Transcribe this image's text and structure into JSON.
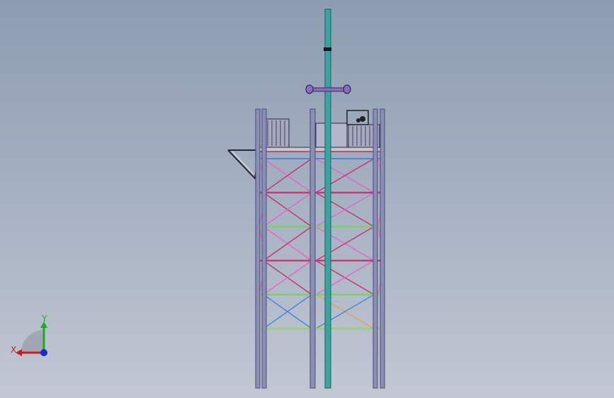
{
  "viewport": {
    "background_top": "#8d9cb1",
    "background_bottom": "#c2c7d3"
  },
  "model": {
    "description_icon": "steel-lattice-tower-model",
    "colors": {
      "column": "#8b8fb8",
      "column_edge": "#4a4d6e",
      "mast": "#3aa5a0",
      "mast_edge": "#1d5f5c",
      "brace_pink": "#e06ac8",
      "brace_magenta": "#c43a78",
      "brace_blue": "#4a8ad8",
      "brace_orange": "#e0a060",
      "beam_green": "#7ad06a",
      "platform": "#c8c8c8"
    }
  },
  "triad": {
    "x_label": "X",
    "y_label": "Y",
    "x_color": "#d11a1a",
    "y_color": "#18b018",
    "z_color": "#1a2ad1"
  }
}
